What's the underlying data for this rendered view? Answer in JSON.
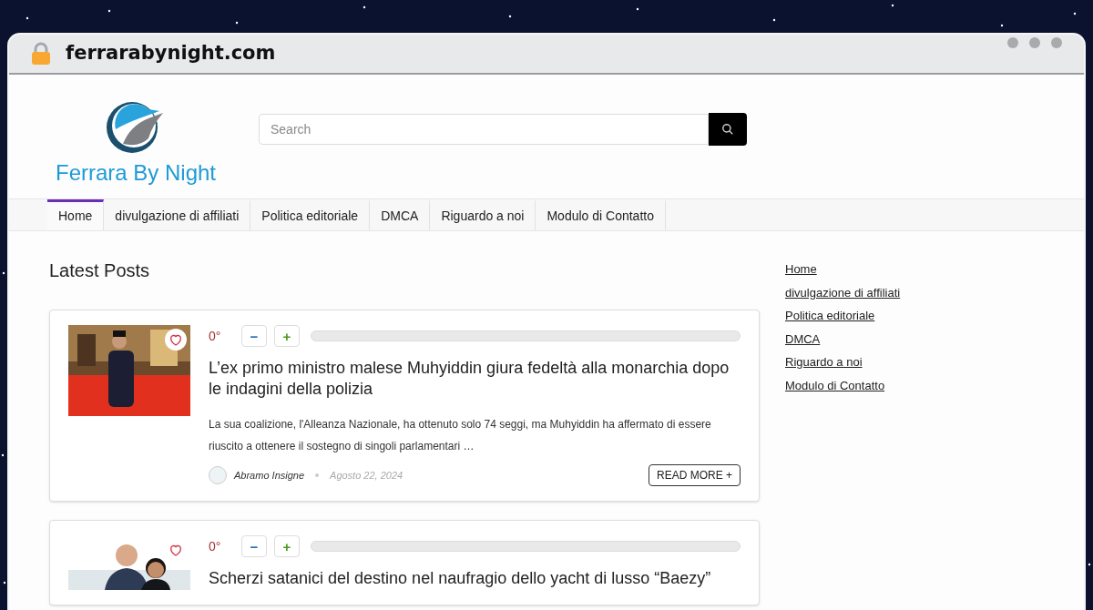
{
  "browser": {
    "url": "ferrarabynight.com"
  },
  "site": {
    "logo_text": "Ferrara By Night",
    "search": {
      "placeholder": "Search"
    }
  },
  "nav": [
    {
      "label": "Home",
      "selected": true
    },
    {
      "label": "divulgazione di affiliati",
      "selected": false
    },
    {
      "label": "Politica editoriale",
      "selected": false
    },
    {
      "label": "DMCA",
      "selected": false
    },
    {
      "label": "Riguardo a noi",
      "selected": false
    },
    {
      "label": "Modulo di Contatto",
      "selected": false
    }
  ],
  "section_title": "Latest Posts",
  "posts": [
    {
      "score": "0°",
      "minus": "−",
      "plus": "+",
      "title": "L’ex primo ministro malese Muhyiddin giura fedeltà alla monarchia dopo le indagini della polizia",
      "excerpt": "La sua coalizione, l'Alleanza Nazionale, ha ottenuto solo 74 seggi, ma Muhyiddin ha affermato di essere riuscito a ottenere il sostegno di singoli parlamentari …",
      "author": "Abramo Insigne",
      "date": "Agosto 22, 2024",
      "read_more": "READ MORE +",
      "liked": false
    },
    {
      "score": "0°",
      "minus": "−",
      "plus": "+",
      "title": "Scherzi satanici del destino nel naufragio dello yacht di lusso “Baezy”",
      "liked": false
    }
  ],
  "sidebar_links": [
    "Home",
    "divulgazione di affiliati",
    "Politica editoriale",
    "DMCA",
    "Riguardo a noi",
    "Modulo di Contatto"
  ]
}
